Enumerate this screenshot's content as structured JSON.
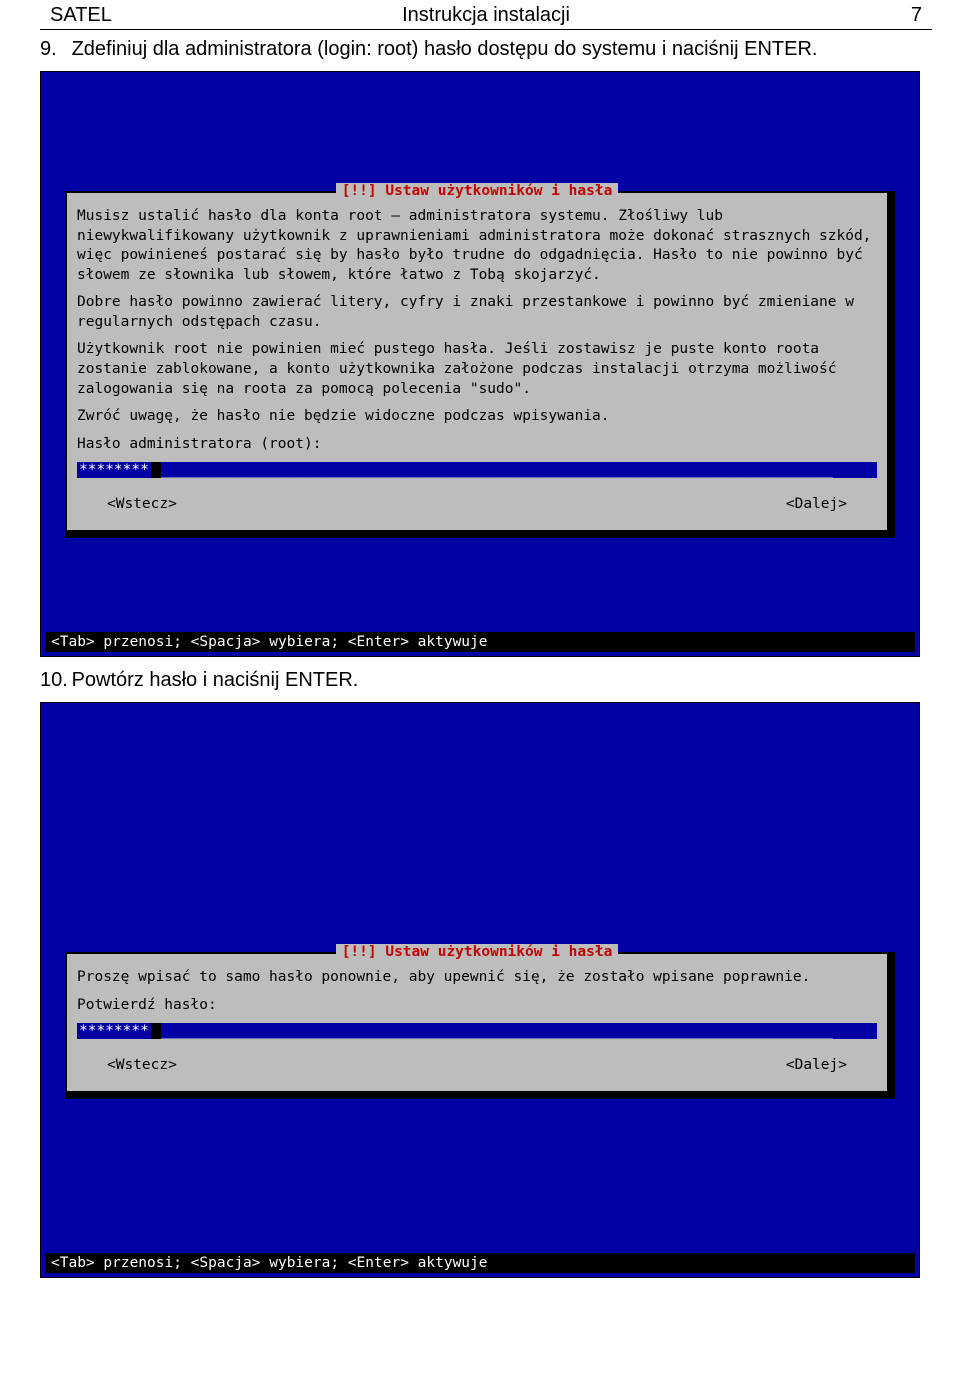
{
  "header": {
    "left": "SATEL",
    "center": "Instrukcja instalacji",
    "right": "7"
  },
  "step9": {
    "num": "9.",
    "text": "Zdefiniuj dla administratora (login: root) hasło dostępu do systemu i naciśnij ENTER."
  },
  "step10": {
    "num": "10.",
    "text": "Powtórz hasło i naciśnij ENTER."
  },
  "dialog1": {
    "title": "[!!] Ustaw użytkowników i hasła",
    "p1": "Musisz ustalić hasło dla konta root – administratora systemu. Złośliwy lub niewykwalifikowany użytkownik z uprawnieniami administratora może dokonać strasznych szkód, więc powinieneś postarać się by hasło było trudne do odgadnięcia. Hasło to nie powinno być słowem ze słownika lub słowem, które łatwo z Tobą skojarzyć.",
    "p2": "Dobre hasło powinno zawierać litery, cyfry i znaki przestankowe i powinno być zmieniane w regularnych odstępach czasu.",
    "p3": "Użytkownik root nie powinien mieć pustego hasła. Jeśli zostawisz je puste konto roota zostanie zablokowane, a konto użytkownika założone podczas instalacji otrzyma możliwość zalogowania się na roota za pomocą polecenia \"sudo\".",
    "p4": "Zwróć uwagę, że hasło nie będzie widoczne podczas wpisywania.",
    "label": "Hasło administratora (root):",
    "typed": "********",
    "underscores": "_____________________________________________________________________________",
    "back": "<Wstecz>",
    "next": "<Dalej>"
  },
  "dialog2": {
    "title": "[!!] Ustaw użytkowników i hasła",
    "p1": "Proszę wpisać to samo hasło ponownie, aby upewnić się, że zostało wpisane poprawnie.",
    "label": "Potwierdź hasło:",
    "typed": "********",
    "underscores": "_____________________________________________________________________________",
    "back": "<Wstecz>",
    "next": "<Dalej>"
  },
  "hint": "<Tab> przenosi; <Spacja> wybiera; <Enter> aktywuje"
}
